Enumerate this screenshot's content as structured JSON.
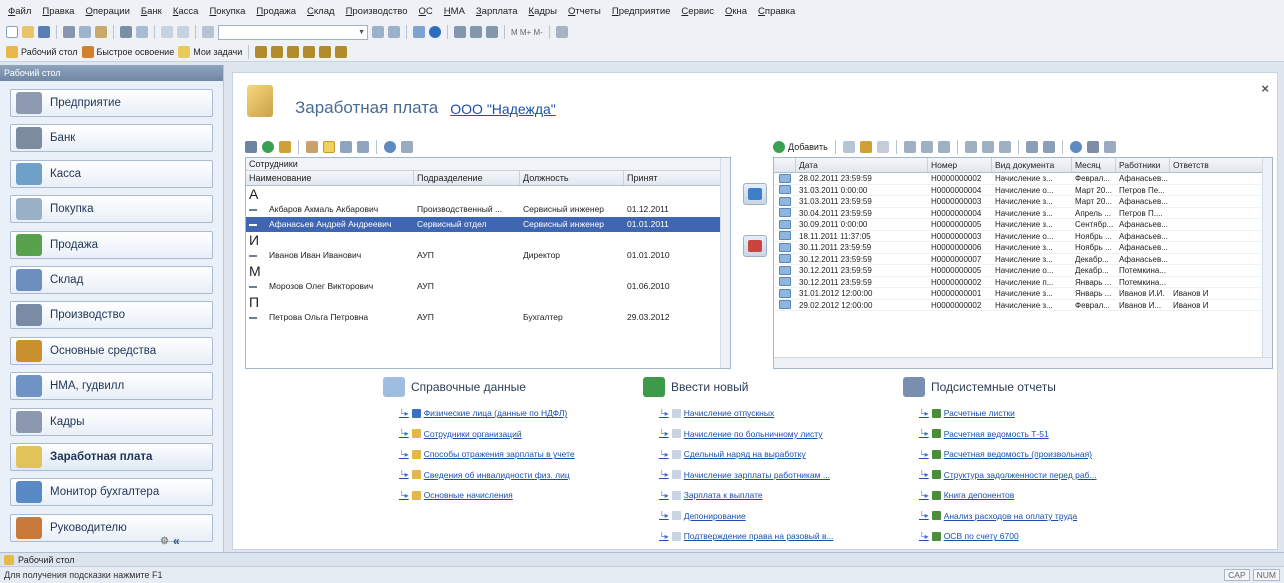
{
  "menu": [
    "Файл",
    "Правка",
    "Операции",
    "Банк",
    "Касса",
    "Покупка",
    "Продажа",
    "Склад",
    "Производство",
    "ОС",
    "НМА",
    "Зарплата",
    "Кадры",
    "Отчеты",
    "Предприятие",
    "Сервис",
    "Окна",
    "Справка"
  ],
  "toolbar2": {
    "desktop": "Рабочий стол",
    "quickstart": "Быстрое освоение",
    "tasks": "Мои задачи"
  },
  "toolbar1": {
    "mem": "M  M+ M-"
  },
  "sidebar": {
    "header": "Рабочий стол",
    "items": [
      {
        "label": "Предприятие",
        "icon": "building-icon"
      },
      {
        "label": "Банк",
        "icon": "bank-icon"
      },
      {
        "label": "Касса",
        "icon": "cash-icon"
      },
      {
        "label": "Покупка",
        "icon": "purchase-icon"
      },
      {
        "label": "Продажа",
        "icon": "sale-icon"
      },
      {
        "label": "Склад",
        "icon": "warehouse-icon"
      },
      {
        "label": "Производство",
        "icon": "production-icon"
      },
      {
        "label": "Основные средства",
        "icon": "truck-icon"
      },
      {
        "label": "НМА, гудвилл",
        "icon": "nma-icon"
      },
      {
        "label": "Кадры",
        "icon": "staff-icon"
      },
      {
        "label": "Заработная плата",
        "icon": "salary-icon",
        "active": true
      },
      {
        "label": "Монитор бухгалтера",
        "icon": "monitor-icon"
      },
      {
        "label": "Руководителю",
        "icon": "manager-icon"
      }
    ]
  },
  "tab": {
    "label": "Рабочий стол"
  },
  "status": {
    "hint": "Для получения подсказки нажмите F1",
    "cap": "CAP",
    "num": "NUM"
  },
  "main": {
    "title": "Заработная плата",
    "org": "ООО \"Надежда\"",
    "add_label": "Добавить",
    "employees": {
      "caption": "Сотрудники",
      "columns": [
        "Наименование",
        "Подразделение",
        "Должность",
        "Принят"
      ],
      "groups": [
        {
          "letter": "А",
          "rows": [
            {
              "name": "Акбаров Акмаль Акбарович",
              "dept": "Производственный ...",
              "pos": "Сервисный инженер",
              "date": "01.12.2011"
            },
            {
              "name": "Афанасьев Андрей Андреевич",
              "dept": "Сервисный отдел",
              "pos": "Сервисный инженер",
              "date": "01.01.2011",
              "selected": true
            }
          ]
        },
        {
          "letter": "И",
          "rows": [
            {
              "name": "Иванов Иван Иванович",
              "dept": "АУП",
              "pos": "Директор",
              "date": "01.01.2010"
            }
          ]
        },
        {
          "letter": "М",
          "rows": [
            {
              "name": "Морозов Олег Викторович",
              "dept": "АУП",
              "pos": "",
              "date": "01.06.2010"
            }
          ]
        },
        {
          "letter": "П",
          "rows": [
            {
              "name": "Петрова Ольга Петровна",
              "dept": "АУП",
              "pos": "Бухгалтер",
              "date": "29.03.2012"
            }
          ]
        }
      ]
    },
    "docs": {
      "columns": [
        "Дата",
        "Номер",
        "Вид документа",
        "Месяц",
        "Работники",
        "Ответств"
      ],
      "rows": [
        {
          "date": "28.02.2011 23:59:59",
          "num": "Н0000000002",
          "type": "Начисление з...",
          "month": "Феврал...",
          "workers": "Афанасьев...",
          "resp": ""
        },
        {
          "date": "31.03.2011 0:00:00",
          "num": "Н0000000004",
          "type": "Начисление о...",
          "month": "Март 20...",
          "workers": "Петров Пе...",
          "resp": ""
        },
        {
          "date": "31.03.2011 23:59:59",
          "num": "Н0000000003",
          "type": "Начисление з...",
          "month": "Март 20...",
          "workers": "Афанасьев...",
          "resp": ""
        },
        {
          "date": "30.04.2011 23:59:59",
          "num": "Н0000000004",
          "type": "Начисление з...",
          "month": "Апрель ...",
          "workers": "Петров П....",
          "resp": ""
        },
        {
          "date": "30.09.2011 0:00:00",
          "num": "Н0000000005",
          "type": "Начисление з...",
          "month": "Сентябр...",
          "workers": "Афанасьев...",
          "resp": ""
        },
        {
          "date": "18.11.2011 11:37:05",
          "num": "Н0000000003",
          "type": "Начисление о...",
          "month": "Ноябрь ...",
          "workers": "Афанасьев...",
          "resp": ""
        },
        {
          "date": "30.11.2011 23:59:59",
          "num": "Н0000000006",
          "type": "Начисление з...",
          "month": "Ноябрь ...",
          "workers": "Афанасьев...",
          "resp": ""
        },
        {
          "date": "30.12.2011 23:59:59",
          "num": "Н0000000007",
          "type": "Начисление з...",
          "month": "Декабр...",
          "workers": "Афанасьев...",
          "resp": ""
        },
        {
          "date": "30.12.2011 23:59:59",
          "num": "Н0000000005",
          "type": "Начисление о...",
          "month": "Декабр...",
          "workers": "Потемкина...",
          "resp": ""
        },
        {
          "date": "30.12.2011 23:59:59",
          "num": "Н0000000002",
          "type": "Начисление п...",
          "month": "Январь ...",
          "workers": "Потемкина...",
          "resp": ""
        },
        {
          "date": "31.01.2012 12:00:00",
          "num": "Н0000000001",
          "type": "Начисление з...",
          "month": "Январь ...",
          "workers": "Иванов И.И.",
          "resp": "Иванов И"
        },
        {
          "date": "29.02.2012 12:00:00",
          "num": "Н0000000002",
          "type": "Начисление з...",
          "month": "Феврал...",
          "workers": "Иванов И...",
          "resp": "Иванов И"
        }
      ]
    },
    "sections": [
      {
        "title": "Справочные данные",
        "links": [
          "Физические лица (данные по НДФЛ)",
          "Сотрудники организаций",
          "Способы отражения зарплаты в учете",
          "Сведения об инвалидности физ. лиц",
          "Основные начисления"
        ]
      },
      {
        "title": "Ввести новый",
        "links": [
          "Начисление отпускных",
          "Начисление по больничному листу",
          "Сдельный наряд на выработку",
          "Начисление зарплаты работникам ...",
          "Зарплата к выплате",
          "Депонирование",
          "Подтверждение права на разовый в..."
        ]
      },
      {
        "title": "Подсистемные отчеты",
        "links": [
          "Расчетные листки",
          "Расчетная ведомость Т-51",
          "Расчетная ведомость (произвольная)",
          "Структура задолженности перед раб...",
          "Книга депонентов",
          "Анализ расходов на оплату труда",
          "ОСВ по счету 6700"
        ]
      }
    ]
  }
}
